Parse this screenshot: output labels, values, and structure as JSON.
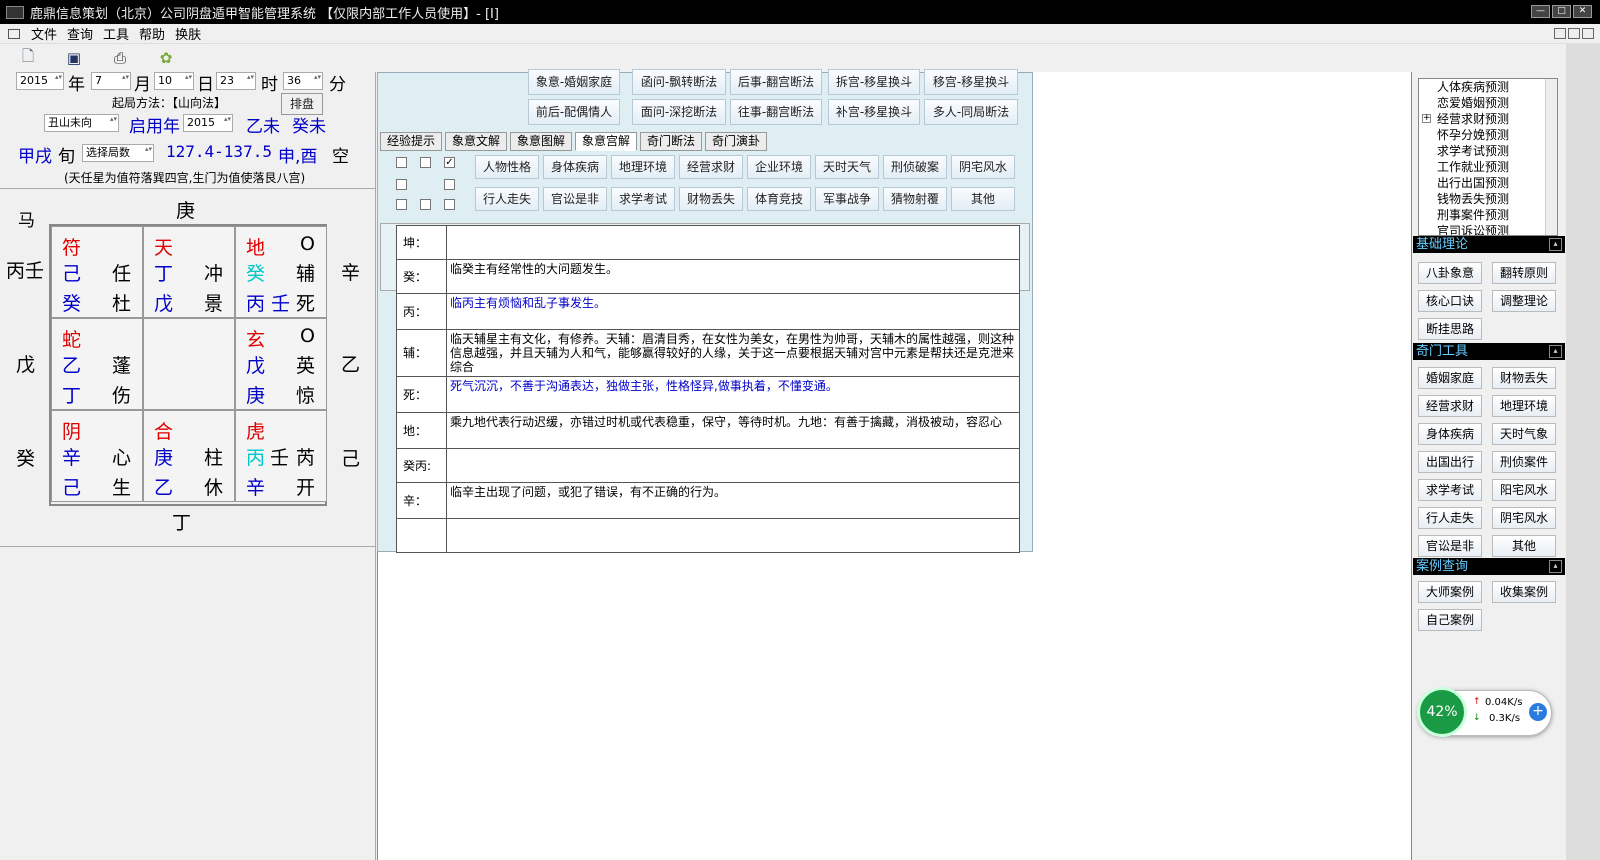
{
  "titlebar": {
    "title": "鹿鼎信息策划（北京）公司阴盘遁甲智能管理系统 【仅限内部工作人员使用】- [I]",
    "btn_min": "—",
    "btn_max": "□",
    "btn_close": "✕"
  },
  "menu": {
    "file": "文件",
    "query": "查询",
    "tools": "工具",
    "help": "帮助",
    "skin": "换肤"
  },
  "date": {
    "year": "2015",
    "year_l": "年",
    "month": "7",
    "month_l": "月",
    "day": "10",
    "day_l": "日",
    "hour": "23",
    "hour_l": "时",
    "min": "36",
    "min_l": "分"
  },
  "method": {
    "label": "起局方法：【山向法】",
    "btn": "排盘"
  },
  "row3": {
    "mountain": "丑山未向",
    "qiyong": "启用年",
    "qiyong_val": "2015",
    "gz1": "乙未",
    "gz2": "癸未"
  },
  "row4": {
    "xun": "甲戌",
    "xun_l": "旬",
    "select": "选择局数",
    "deg": "127.4-137.5",
    "kong": "申,酉",
    "kong_l": "空"
  },
  "note": "(天任星为值符落巽四宫,生门为值使落艮八宫)",
  "board": {
    "top_left": "马",
    "top": "庚",
    "bottom": "丁",
    "left_top": "丙壬",
    "left_mid": "戊",
    "left_bot": "癸",
    "right_top": "辛",
    "right_mid": "乙",
    "right_bot": "己",
    "cells": [
      {
        "a": "符",
        "b": "",
        "c": "己",
        "d": "任",
        "e": "癸",
        "f": "杜"
      },
      {
        "a": "天",
        "b": "",
        "c": "丁",
        "d": "冲",
        "e": "戊",
        "f": "景"
      },
      {
        "a": "地",
        "b": "O",
        "c": "癸",
        "d": "辅",
        "e": "丙 壬",
        "f": "死"
      },
      {
        "a": "蛇",
        "b": "",
        "c": "乙",
        "d": "蓬",
        "e": "丁",
        "f": "伤"
      },
      {
        "a": "",
        "b": "",
        "c": "",
        "d": "",
        "e": "",
        "f": ""
      },
      {
        "a": "玄",
        "b": "O",
        "c": "戊",
        "d": "英",
        "e": "庚",
        "f": "惊"
      },
      {
        "a": "阴",
        "b": "",
        "c": "辛",
        "d": "心",
        "e": "己",
        "f": "生"
      },
      {
        "a": "合",
        "b": "",
        "c": "庚",
        "d": "柱",
        "e": "乙",
        "f": "休"
      },
      {
        "a": "虎",
        "b": "",
        "c": "丙",
        "c2": "壬",
        "d": "芮",
        "e": "辛",
        "f": "开"
      }
    ]
  },
  "topbtns": [
    "象意-婚姻家庭",
    "函问-飘转断法",
    "后事-翻宫断法",
    "拆宫-移星换斗",
    "移宫-移星换斗",
    "前后-配偶情人",
    "面问-深挖断法",
    "往事-翻宫断法",
    "补宫-移星换斗",
    "多人-同局断法"
  ],
  "tabs": [
    "经验提示",
    "象意文解",
    "象意图解",
    "象意宫解",
    "奇门断法",
    "奇门演卦"
  ],
  "topics": [
    "人物性格",
    "身体疾病",
    "地理环境",
    "经营求财",
    "企业环境",
    "天时天气",
    "刑侦破案",
    "阴宅风水",
    "行人走失",
    "官讼是非",
    "求学考试",
    "财物丢失",
    "体育竞技",
    "军事战争",
    "猜物射覆",
    "其他"
  ],
  "table": [
    {
      "k": "坤：",
      "v": "",
      "color": "#000"
    },
    {
      "k": "癸：",
      "v": "临癸主有经常性的大问题发生。",
      "color": "#000"
    },
    {
      "k": "丙：",
      "v": "临丙主有烦恼和乱子事发生。",
      "color": "#0000c8"
    },
    {
      "k": "辅：",
      "v": "临天辅星主有文化，有修养。天辅：眉清目秀，在女性为美女，在男性为帅哥，天辅木的属性越强，则这种信息越强，并且天辅为人和气，能够赢得较好的人缘，关于这一点要根据天辅对宫中元素是帮扶还是克泄来综合",
      "color": "#000"
    },
    {
      "k": "死：",
      "v": "死气沉沉，不善于沟通表达，独做主张，性格怪异,做事执着，不懂变通。",
      "color": "#0000c8"
    },
    {
      "k": "地：",
      "v": "乘九地代表行动迟缓，亦错过时机或代表稳重，保守，等待时机。九地：有善于擒藏，消极被动，容忍心",
      "color": "#000"
    },
    {
      "k": "癸丙:",
      "v": "",
      "color": "#000"
    },
    {
      "k": "辛：",
      "v": "临辛主出现了问题，或犯了错误，有不正确的行为。",
      "color": "#000"
    },
    {
      "k": "",
      "v": "",
      "color": "#000"
    }
  ],
  "tree": [
    "人体疾病预测",
    "恋爱婚姻预测",
    "经营求财预测",
    "怀孕分娩预测",
    "求学考试预测",
    "工作就业预测",
    "出行出国预测",
    "钱物丢失预测",
    "刑事案件预测",
    "官司诉讼预测"
  ],
  "sections": {
    "basic": "基础理论",
    "tools": "奇门工具",
    "cases": "案例查询"
  },
  "basic_btns": [
    "八卦象意",
    "翻转原则",
    "核心口诀",
    "调整理论",
    "断挂思路"
  ],
  "tool_btns": [
    "婚姻家庭",
    "财物丢失",
    "经营求财",
    "地理环境",
    "身体疾病",
    "天时气象",
    "出国出行",
    "刑侦案件",
    "求学考试",
    "阳宅风水",
    "行人走失",
    "阴宅风水",
    "官讼是非",
    "其他"
  ],
  "case_btns": [
    "大师案例",
    "收集案例",
    "自己案例"
  ],
  "net": {
    "pct": "42%",
    "up": "0.04K/s",
    "down": "0.3K/s",
    "plus": "+"
  }
}
